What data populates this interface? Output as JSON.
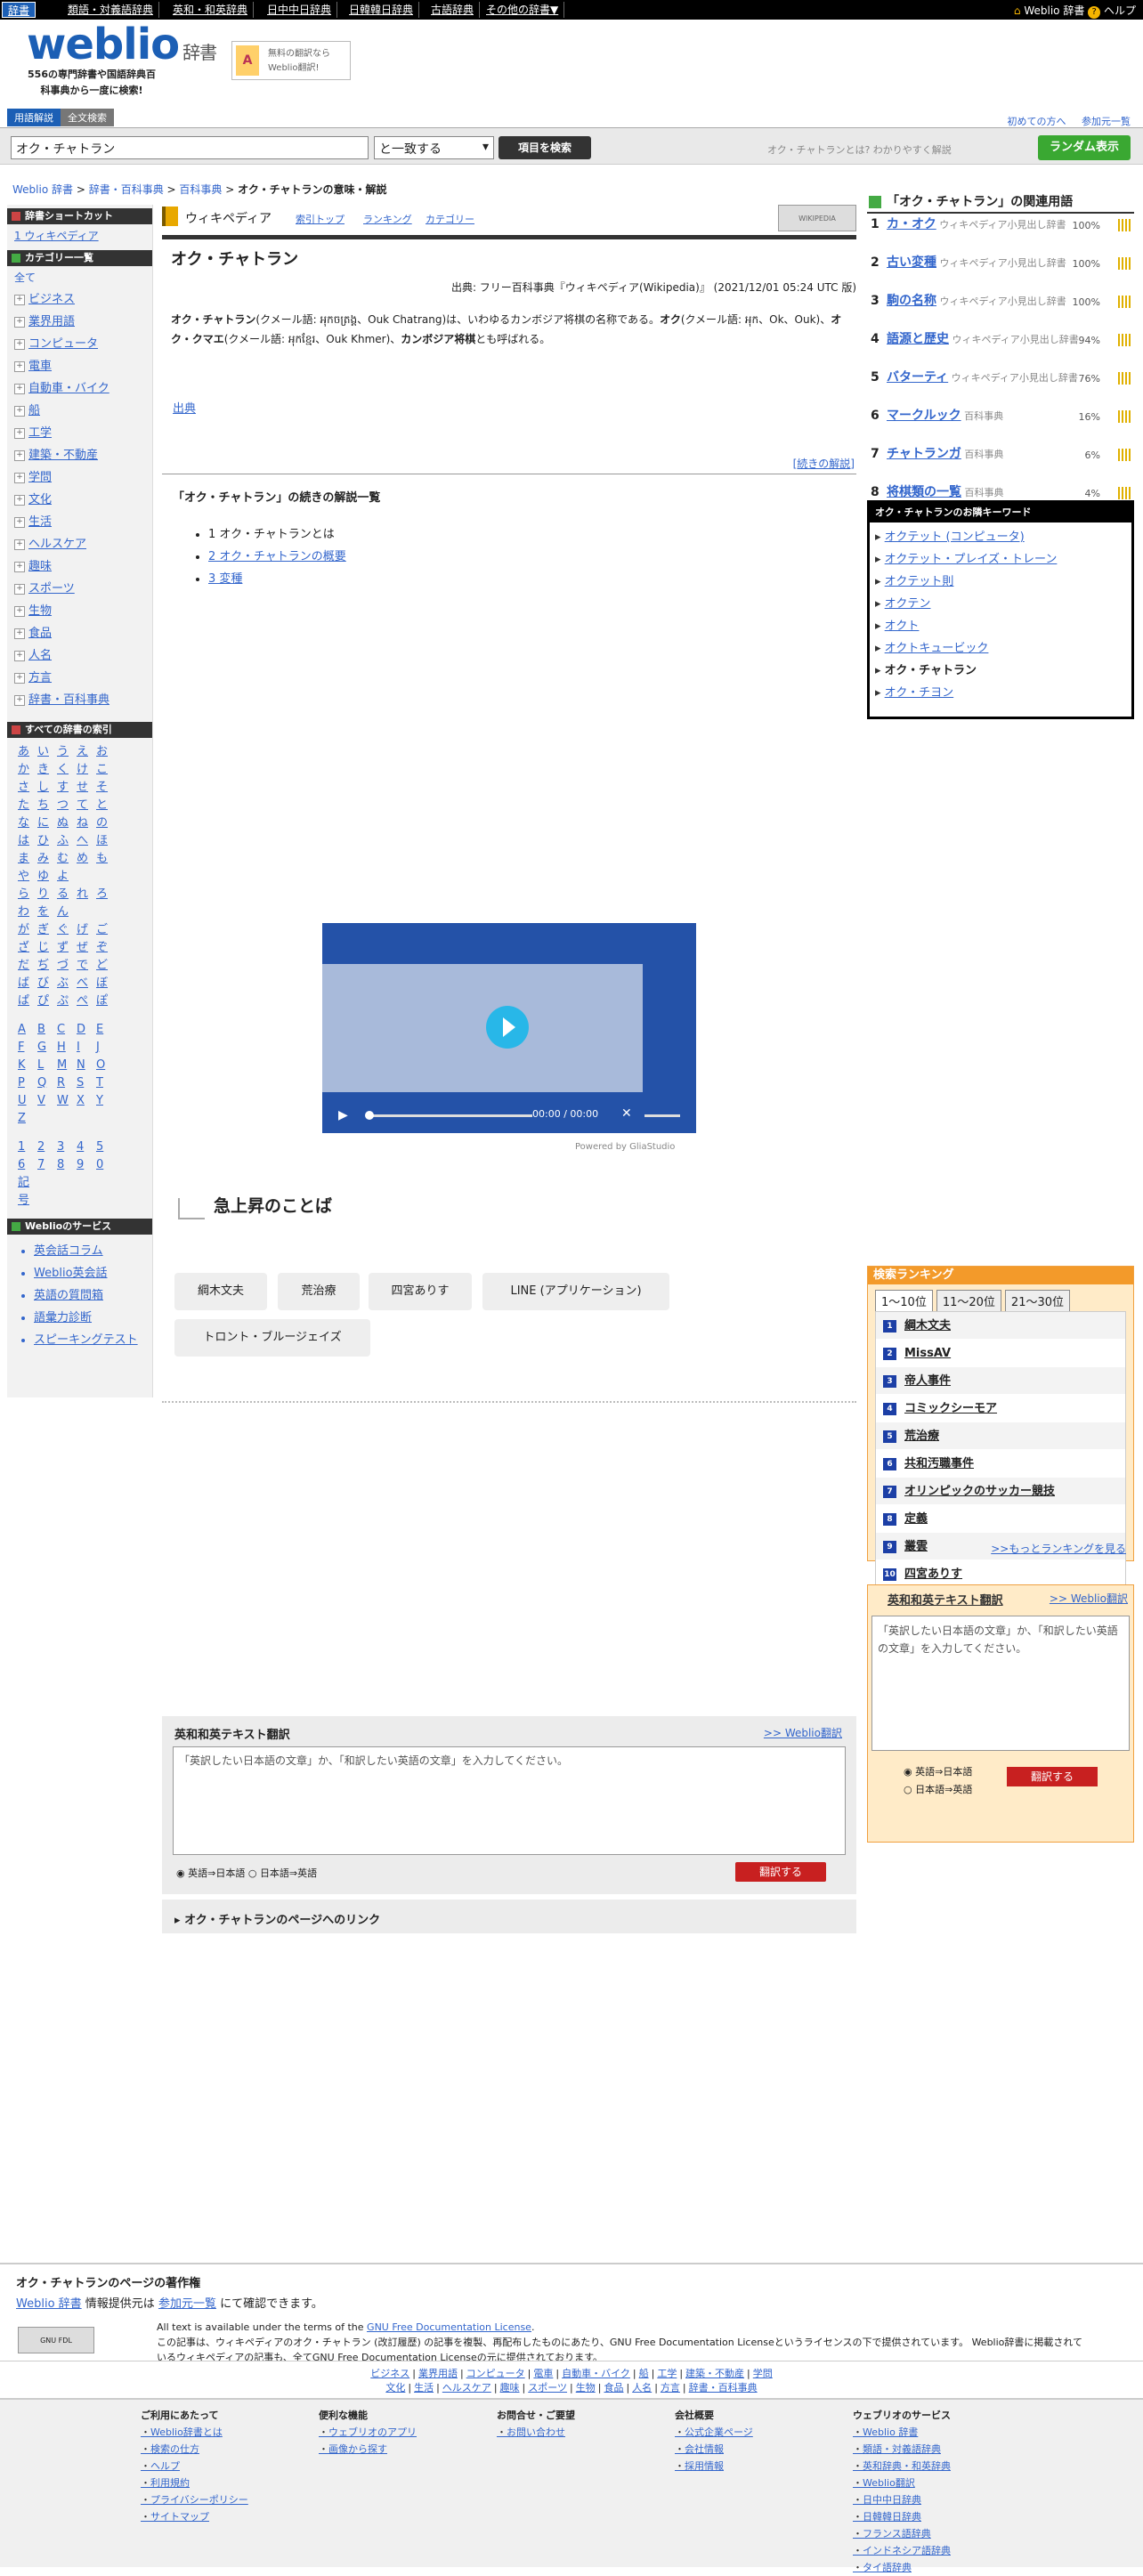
{
  "topbar": {
    "items": [
      "辞書",
      "類語・対義語辞典",
      "英和・和英辞典",
      "日中中日辞典",
      "日韓韓日辞典",
      "古語辞典",
      "その他の辞書▼"
    ],
    "right_brand": "Weblio 辞書",
    "right_help": "ヘルプ"
  },
  "header": {
    "logo": "weblio",
    "logo_suffix": "辞書",
    "tagline": "556の専門辞書や国語辞典百科事典から一度に検索!",
    "promo": "無料の翻訳なら Weblio翻訳!",
    "promo_icon": "A"
  },
  "tabs": [
    "用語解説",
    "全文検索"
  ],
  "topnav": [
    "初めての方へ",
    "参加元一覧"
  ],
  "search": {
    "value": "オク・チャトラン",
    "match": "と一致する",
    "button": "項目を検索",
    "hint": "オク・チャトランとは? わかりやすく解説",
    "random": "ランダム表示"
  },
  "breadcrumb": {
    "l1": "Weblio 辞書",
    "l2": "辞書・百科事典",
    "l3": "百科事典",
    "current": "オク・チャトランの意味・解説"
  },
  "left": {
    "shortcut_h": "辞書ショートカット",
    "shortcut": "1 ウィキペディア",
    "cat_h": "カテゴリー一覧",
    "cat_all": "全て",
    "cats": [
      "ビジネス",
      "業界用語",
      "コンピュータ",
      "電車",
      "自動車・バイク",
      "船",
      "工学",
      "建築・不動産",
      "学問",
      "文化",
      "生活",
      "ヘルスケア",
      "趣味",
      "スポーツ",
      "生物",
      "食品",
      "人名",
      "方言",
      "辞書・百科事典"
    ],
    "index_h": "すべての辞書の索引",
    "kana": [
      "あいうえお",
      "かきくけこ",
      "さしすせそ",
      "たちつてと",
      "なにぬねの",
      "はひふへほ",
      "まみむめも",
      "やゆよ",
      "らりるれろ",
      "わをん",
      "がぎぐげご",
      "ざじずぜぞ",
      "だぢづでど",
      "ばびぶべぼ",
      "ぱぴぷぺぽ"
    ],
    "alpha": [
      "ABCDE",
      "FGHIJ",
      "KLMNO",
      "PQRST",
      "UVWXY",
      "Z"
    ],
    "nums": [
      "12345",
      "67890"
    ],
    "kigo": "記号",
    "svc_h": "Weblioのサービス",
    "svc": [
      "英会話コラム",
      "Weblio英会話",
      "英語の質問箱",
      "語彙力診断",
      "スピーキングテスト"
    ]
  },
  "article": {
    "dict": "ウィキペディア",
    "links": [
      "索引トップ",
      "ランキング",
      "カテゴリー"
    ],
    "wiki_logo": "WIKIPEDIA",
    "title": "オク・チャトラン",
    "source": "出典: フリー百科事典『ウィキペディア(Wikipedia)』 (2021/12/01 05:24 UTC 版)",
    "def_b1": "オク・チャトラン",
    "def_t1": "(クメール語: អុកចត្រង្គ、Ouk Chatrang)は、いわゆるカンボジア将棋の名称である。",
    "def_b2": "オク",
    "def_t2": "(クメール語: អុក、Ok、Ouk)、",
    "def_b3": "オク・クマエ",
    "def_t3": "(クメール語: អុកខ្មែរ、Ouk Khmer)、",
    "def_b4": "カンボジア将棋",
    "def_t4": "とも呼ばれる。",
    "shuten": "出典",
    "more": "[続きの解説]",
    "toc_h": "「オク・チャトラン」の続きの解説一覧",
    "toc": [
      "1 オク・チャトランとは",
      "2 オク・チャトランの概要",
      "3 変種"
    ]
  },
  "video": {
    "time": "00:00 / 00:00",
    "powered": "Powered by GliaStudio"
  },
  "rising": {
    "h": "急上昇のことば",
    "chips": [
      "綱木文夫",
      "荒治療",
      "四宮ありす",
      "LINE (アプリケーション)",
      "トロント・ブルージェイズ"
    ]
  },
  "trans": {
    "h": "英和和英テキスト翻訳",
    "link": ">> Weblio翻訳",
    "placeholder": "「英訳したい日本語の文章」か、「和訳したい英語の文章」を入力してください。",
    "r1": "英語⇒日本語",
    "r2": "日本語⇒英語",
    "btn": "翻訳する"
  },
  "pagelink": "オク・チャトランのページへのリンク",
  "related": {
    "h": "「オク・チャトラン」の関連用語",
    "items": [
      {
        "n": "1",
        "w": "カ・オク",
        "s": "ウィキペディア小見出し辞書",
        "p": "100%"
      },
      {
        "n": "2",
        "w": "古い変種",
        "s": "ウィキペディア小見出し辞書",
        "p": "100%"
      },
      {
        "n": "3",
        "w": "駒の名称",
        "s": "ウィキペディア小見出し辞書",
        "p": "100%"
      },
      {
        "n": "4",
        "w": "語源と歴史",
        "s": "ウィキペディア小見出し辞書",
        "p": "94%"
      },
      {
        "n": "5",
        "w": "バターティ",
        "s": "ウィキペディア小見出し辞書",
        "p": "76%"
      },
      {
        "n": "6",
        "w": "マークルック",
        "s": "百科事典",
        "p": "16%"
      },
      {
        "n": "7",
        "w": "チャトランガ",
        "s": "百科事典",
        "p": "6%"
      },
      {
        "n": "8",
        "w": "将棋類の一覧",
        "s": "百科事典",
        "p": "4%"
      }
    ]
  },
  "keywords": {
    "h": "オク・チャトランのお隣キーワード",
    "items": [
      "オクテット (コンピュータ)",
      "オクテット・プレイズ・トレーン",
      "オクテット則",
      "オクテン",
      "オクト",
      "オクトキュービック",
      "オク・チャトラン",
      "オク・チヨン"
    ]
  },
  "ranking": {
    "h": "検索ランキング",
    "tabs": [
      "1〜10位",
      "11〜20位",
      "21〜30位"
    ],
    "items": [
      "綱木文夫",
      "MissAV",
      "帝人事件",
      "コミックシーモア",
      "荒治療",
      "共和汚職事件",
      "オリンピックのサッカー競技",
      "定義",
      "叢雲",
      "四宮ありす"
    ],
    "more": ">>もっとランキングを見る"
  },
  "copyright": {
    "h": "オク・チャトランのページの著作権",
    "l1a": "Weblio 辞書",
    "l1b": "情報提供元は",
    "l1c": "参加元一覧",
    "l1d": "にて確認できます。",
    "t1": "All text is available under the terms of the ",
    "t2": "GNU Free Documentation License",
    "t3": "この記事は、ウィキペディアのオク・チャトラン (改訂履歴) の記事を複製、再配布したものにあたり、GNU Free Documentation Licenseというライセンスの下で提供されています。 Weblio辞書に掲載されているウィキペディアの記事も、全てGNU Free Documentation Licenseの元に提供されております。",
    "gnu": "GNU FDL"
  },
  "footcats": {
    "row1": [
      "ビジネス",
      "業界用語",
      "コンピュータ",
      "電車",
      "自動車・バイク",
      "船",
      "工学",
      "建築・不動産",
      "学問"
    ],
    "row2": [
      "文化",
      "生活",
      "ヘルスケア",
      "趣味",
      "スポーツ",
      "生物",
      "食品",
      "人名",
      "方言",
      "辞書・百科事典"
    ]
  },
  "footer": [
    {
      "h": "ご利用にあたって",
      "items": [
        "Weblio辞書とは",
        "検索の仕方",
        "ヘルプ",
        "利用規約",
        "プライバシーポリシー",
        "サイトマップ"
      ]
    },
    {
      "h": "便利な機能",
      "items": [
        "ウェブリオのアプリ",
        "画像から探す"
      ]
    },
    {
      "h": "お問合せ・ご要望",
      "items": [
        "お問い合わせ"
      ]
    },
    {
      "h": "会社概要",
      "items": [
        "公式企業ページ",
        "会社情報",
        "採用情報"
      ]
    },
    {
      "h": "ウェブリオのサービス",
      "items": [
        "Weblio 辞書",
        "類語・対義語辞典",
        "英和辞典・和英辞典",
        "Weblio翻訳",
        "日中中日辞典",
        "日韓韓日辞典",
        "フランス語辞典",
        "インドネシア語辞典",
        "タイ語辞典"
      ]
    }
  ]
}
